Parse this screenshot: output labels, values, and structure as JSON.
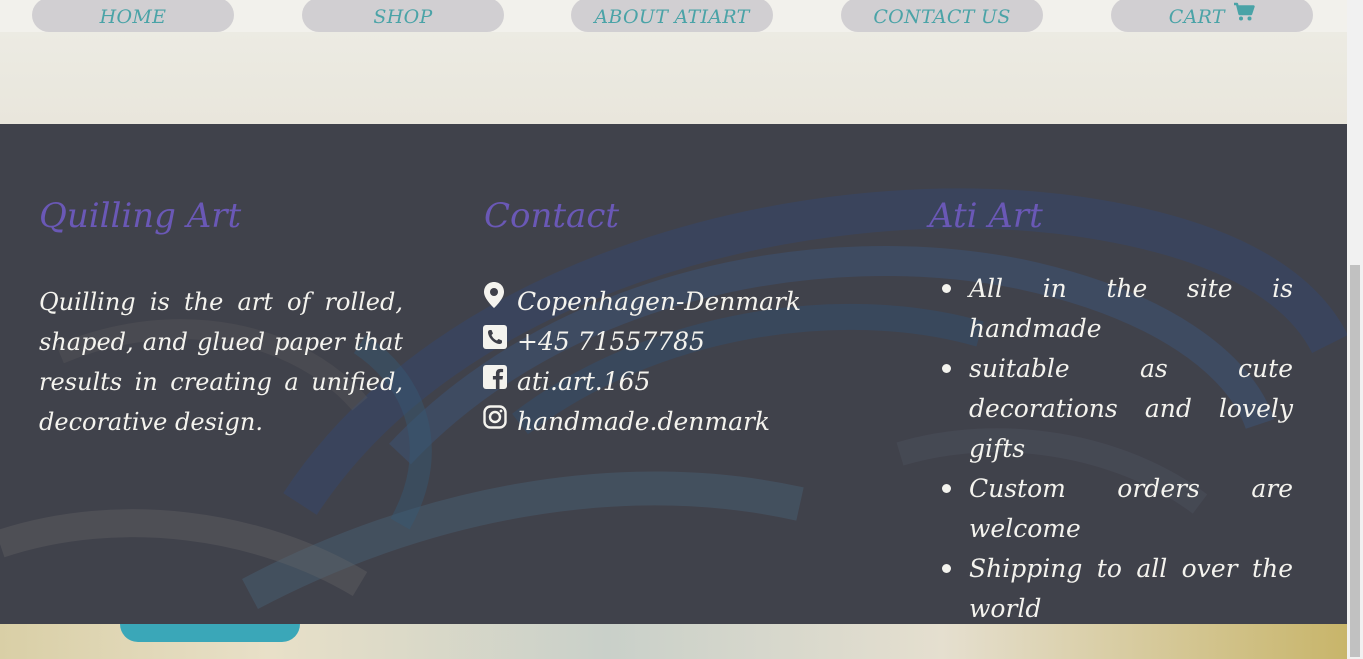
{
  "nav": {
    "items": [
      {
        "label": "HOME"
      },
      {
        "label": "SHOP"
      },
      {
        "label": "ABOUT ATIART"
      },
      {
        "label": "CONTACT US"
      },
      {
        "label": "CART"
      }
    ],
    "cart_icon": "shopping-cart-icon"
  },
  "footer": {
    "about": {
      "title": "Quilling Art",
      "text": "Quilling is the art of rolled, shaped, and glued paper that results in creating a unified, decorative design."
    },
    "contact": {
      "title": "Contact",
      "items": [
        {
          "icon": "map-marker-icon",
          "text": "Copenhagen-Denmark"
        },
        {
          "icon": "phone-icon",
          "text": "+45 71557785"
        },
        {
          "icon": "facebook-icon",
          "text": "ati.art.165"
        },
        {
          "icon": "instagram-icon",
          "text": "handmade.denmark"
        }
      ]
    },
    "info": {
      "title": "Ati Art",
      "items": [
        "All in the site is handmade",
        "suitable as cute decorations and lovely gifts",
        "Custom orders are welcome",
        "Shipping to all over the world"
      ]
    }
  },
  "colors": {
    "nav_button_bg": "#d1cfd2",
    "nav_text": "#4aa3a7",
    "footer_title": "#6a58b6",
    "footer_text": "#f4f3ee",
    "footer_overlay": "#3e3f48"
  }
}
